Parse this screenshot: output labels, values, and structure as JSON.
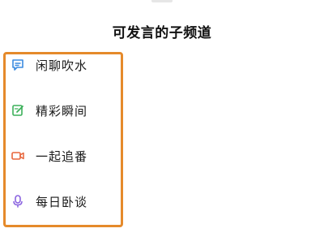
{
  "header": {
    "title": "可发言的子频道"
  },
  "channels": [
    {
      "label": "闲聊吹水",
      "icon": "chat-bubble-icon",
      "color": "#3b8be0"
    },
    {
      "label": "精彩瞬间",
      "icon": "edit-note-icon",
      "color": "#3cb05a"
    },
    {
      "label": "一起追番",
      "icon": "video-icon",
      "color": "#e8663c"
    },
    {
      "label": "每日卧谈",
      "icon": "microphone-icon",
      "color": "#8a63e0"
    }
  ],
  "highlight": {
    "color": "#e58a2b"
  }
}
